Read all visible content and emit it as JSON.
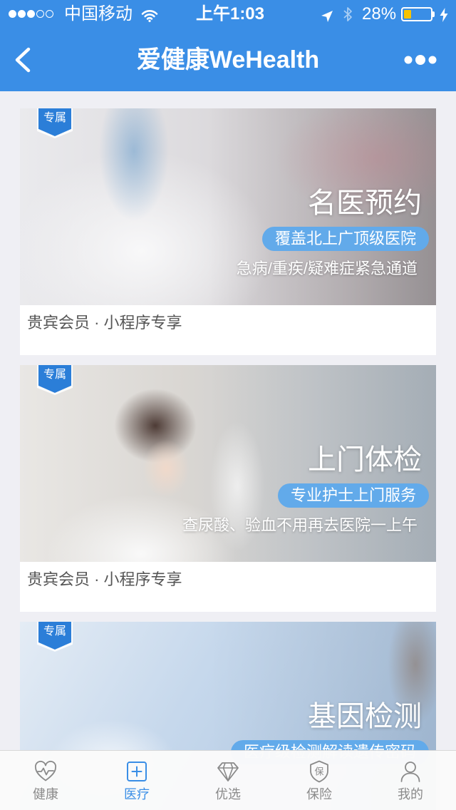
{
  "status_bar": {
    "signal_strength": 3,
    "signal_max": 5,
    "carrier": "中国移动",
    "time": "上午1:03",
    "battery_percent": "28%",
    "battery_level": 0.28,
    "icons": [
      "wifi-icon",
      "location-arrow-icon",
      "bluetooth-icon",
      "battery-icon",
      "charging-bolt-icon"
    ]
  },
  "nav": {
    "title": "爱健康WeHealth",
    "left_icon": "chevron-left-icon",
    "right_icon": "more-dots-icon"
  },
  "cards": [
    {
      "badge": "专属",
      "title": "名医预约",
      "tag": "覆盖北上广顶级医院",
      "description": "急病/重疾/疑难症紧急通道",
      "caption": "贵宾会员 · 小程序专享"
    },
    {
      "badge": "专属",
      "title": "上门体检",
      "tag": "专业护士上门服务",
      "description": "查尿酸、验血不用再去医院一上午",
      "caption": "贵宾会员 · 小程序专享"
    },
    {
      "badge": "专属",
      "title": "基因检测",
      "tag": "医疗级检测解读遗传密码"
    }
  ],
  "tabbar": {
    "active_index": 1,
    "items": [
      {
        "label": "健康",
        "icon": "heart-pulse-icon"
      },
      {
        "label": "医疗",
        "icon": "medical-plus-icon"
      },
      {
        "label": "优选",
        "icon": "diamond-icon"
      },
      {
        "label": "保险",
        "icon": "shield-icon",
        "icon_text": "保"
      },
      {
        "label": "我的",
        "icon": "person-icon"
      }
    ]
  },
  "colors": {
    "primary": "#3a8ee6",
    "page_background": "#efeff4",
    "tag_background": "#62aaea",
    "badge": "#2b7ed8",
    "tab_inactive": "#8a8a8a",
    "battery_fill": "#f7c300"
  }
}
